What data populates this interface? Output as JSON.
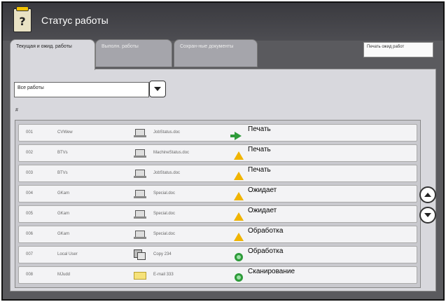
{
  "window": {
    "title": "Статус работы",
    "icon": "question-document-icon"
  },
  "tabs": [
    {
      "label": "Текущая и ожид. работы",
      "active": true
    },
    {
      "label": "Выполн. работы",
      "active": false
    },
    {
      "label": "Сохран-ные документы",
      "active": false
    }
  ],
  "status_box": "Печать ожид работ",
  "filter": {
    "value": "Все работы"
  },
  "list_marker": "#",
  "jobs": [
    {
      "num": "001",
      "user": "CVWew",
      "file": "JobStatus.doc",
      "status": "Печать",
      "doc_icon": "printer-icon",
      "status_icon": "arrow-icon"
    },
    {
      "num": "002",
      "user": "BTVs",
      "file": "MachineStatus.doc",
      "status": "Печать",
      "doc_icon": "printer-icon",
      "status_icon": "warning-icon"
    },
    {
      "num": "003",
      "user": "BTVs",
      "file": "JobStatus.doc",
      "status": "Печать",
      "doc_icon": "printer-icon",
      "status_icon": "warning-icon"
    },
    {
      "num": "004",
      "user": "GKam",
      "file": "Special.doc",
      "status": "Ожидает",
      "doc_icon": "printer-icon",
      "status_icon": "warning-icon"
    },
    {
      "num": "005",
      "user": "GKam",
      "file": "Special.doc",
      "status": "Ожидает",
      "doc_icon": "printer-icon",
      "status_icon": "warning-icon"
    },
    {
      "num": "006",
      "user": "GKam",
      "file": "Special.doc",
      "status": "Обработка",
      "doc_icon": "printer-icon",
      "status_icon": "warning-icon"
    },
    {
      "num": "007",
      "user": "Local User",
      "file": "Copy 234",
      "status": "Обработка",
      "doc_icon": "copy-icon",
      "status_icon": "processing-icon"
    },
    {
      "num": "008",
      "user": "MJudd",
      "file": "E-mail 333",
      "status": "Сканирование",
      "doc_icon": "email-icon",
      "status_icon": "processing-icon"
    }
  ]
}
